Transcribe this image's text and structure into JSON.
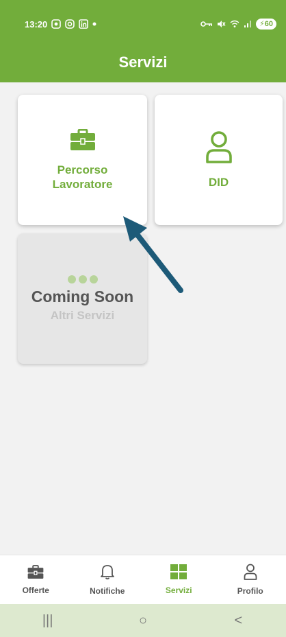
{
  "status_bar": {
    "time": "13:20",
    "battery": "60"
  },
  "header": {
    "title": "Servizi"
  },
  "cards": [
    {
      "label": "Percorso\nLavoratore",
      "icon": "briefcase-icon"
    },
    {
      "label": "DID",
      "icon": "user-icon"
    },
    {
      "title": "Coming Soon",
      "subtitle": "Altri Servizi",
      "icon": "dots-icon"
    }
  ],
  "bottom_nav": {
    "items": [
      {
        "label": "Offerte",
        "icon": "briefcase-icon",
        "active": false
      },
      {
        "label": "Notifiche",
        "icon": "bell-icon",
        "active": false
      },
      {
        "label": "Servizi",
        "icon": "grid-icon",
        "active": true
      },
      {
        "label": "Profilo",
        "icon": "user-icon",
        "active": false
      }
    ]
  },
  "system_nav": {
    "recents": "|||",
    "home": "○",
    "back": "<"
  },
  "colors": {
    "accent": "#72ad3b",
    "arrow": "#1d5a78",
    "background": "#f2f2f2"
  }
}
